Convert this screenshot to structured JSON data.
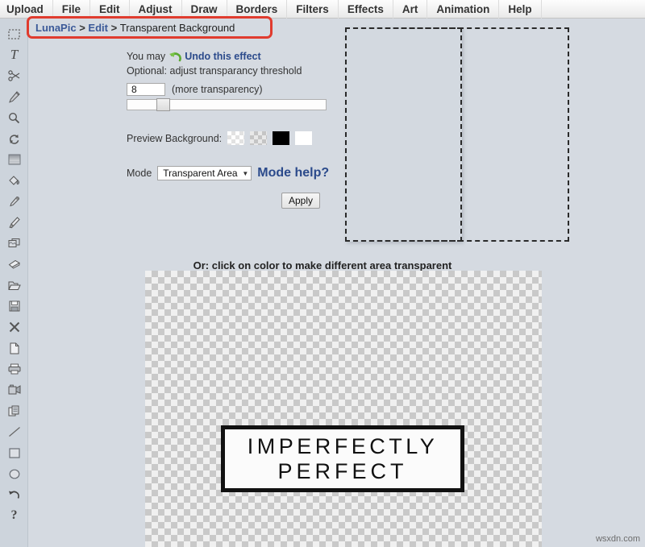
{
  "menubar": {
    "items": [
      {
        "label": "Upload",
        "name": "menu-upload"
      },
      {
        "label": "File",
        "name": "menu-file"
      },
      {
        "label": "Edit",
        "name": "menu-edit"
      },
      {
        "label": "Adjust",
        "name": "menu-adjust"
      },
      {
        "label": "Draw",
        "name": "menu-draw"
      },
      {
        "label": "Borders",
        "name": "menu-borders"
      },
      {
        "label": "Filters",
        "name": "menu-filters"
      },
      {
        "label": "Effects",
        "name": "menu-effects"
      },
      {
        "label": "Art",
        "name": "menu-art"
      },
      {
        "label": "Animation",
        "name": "menu-animation"
      },
      {
        "label": "Help",
        "name": "menu-help"
      }
    ]
  },
  "toolbar": {
    "tools": [
      {
        "icon": "marquee-select-icon"
      },
      {
        "icon": "text-tool-icon"
      },
      {
        "icon": "scissors-icon"
      },
      {
        "icon": "pencil-icon"
      },
      {
        "icon": "magnifier-icon"
      },
      {
        "icon": "rotate-icon"
      },
      {
        "icon": "gradient-icon"
      },
      {
        "icon": "paint-bucket-icon"
      },
      {
        "icon": "eyedropper-icon"
      },
      {
        "icon": "paintbrush-icon"
      },
      {
        "icon": "clone-stamp-icon"
      },
      {
        "icon": "eraser-icon"
      },
      {
        "icon": "open-folder-icon"
      },
      {
        "icon": "save-disk-icon"
      },
      {
        "icon": "close-x-icon"
      },
      {
        "icon": "new-page-icon"
      },
      {
        "icon": "printer-icon"
      },
      {
        "icon": "camera-icon"
      },
      {
        "icon": "copy-icon"
      },
      {
        "icon": "line-tool-icon"
      },
      {
        "icon": "rectangle-tool-icon"
      },
      {
        "icon": "ellipse-tool-icon"
      },
      {
        "icon": "undo-icon"
      },
      {
        "icon": "help-question-icon"
      }
    ]
  },
  "breadcrumb": {
    "root": "LunaPic",
    "sep": " > ",
    "section": "Edit",
    "current": "Transparent Background",
    "highlight_color": "#e03b2e"
  },
  "controls": {
    "undo_prefix": "You may",
    "undo_link": "Undo this effect",
    "optional_label": "Optional: adjust transparancy threshold",
    "threshold_value": "8",
    "threshold_hint": "(more transparency)",
    "slider_percent": 16,
    "preview_bg_label": "Preview Background:",
    "swatches": [
      {
        "name": "swatch-checker-light",
        "kind": "check-light"
      },
      {
        "name": "swatch-checker-gray",
        "kind": "check-gray"
      },
      {
        "name": "swatch-black",
        "kind": "black",
        "color": "#000000"
      },
      {
        "name": "swatch-white",
        "kind": "white",
        "color": "#ffffff"
      }
    ],
    "mode_label": "Mode",
    "mode_value": "Transparent Area",
    "mode_caret": "▼",
    "mode_help_link": "Mode help?",
    "apply_label": "Apply"
  },
  "caption": "Or: click on color to make different area transparent",
  "image": {
    "line1": "IMPERFECTLY",
    "line2": "PERFECT"
  },
  "watermark": "wsxdn.com"
}
